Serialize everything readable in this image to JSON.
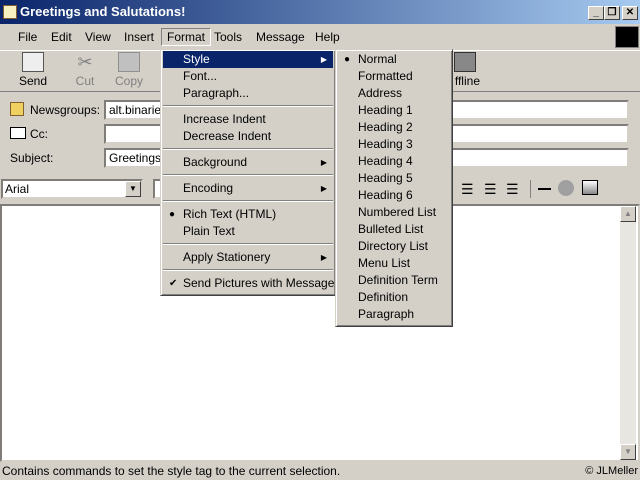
{
  "window": {
    "title": "Greetings and Salutations!",
    "minimize": "_",
    "restore": "❐",
    "close": "✕"
  },
  "menubar": [
    "File",
    "Edit",
    "View",
    "Insert",
    "Format",
    "Tools",
    "Message",
    "Help"
  ],
  "toolbar": {
    "send": "Send",
    "cut": "Cut",
    "copy": "Copy",
    "offline": "ffline"
  },
  "fields": {
    "newsgroups_label": "Newsgroups:",
    "newsgroups_value": "alt.binaries",
    "cc_label": "Cc:",
    "cc_value": "",
    "subject_label": "Subject:",
    "subject_value": "Greetings a"
  },
  "format_bar": {
    "font": "Arial",
    "size": ""
  },
  "format_menu": [
    {
      "label": "Style",
      "submenu": true,
      "highlighted": true
    },
    {
      "label": "Font..."
    },
    {
      "label": "Paragraph..."
    },
    {
      "label": "Increase Indent"
    },
    {
      "label": "Decrease Indent"
    },
    {
      "label": "Background",
      "submenu": true
    },
    {
      "label": "Encoding",
      "submenu": true
    },
    {
      "label": "Rich Text (HTML)",
      "bullet": true
    },
    {
      "label": "Plain Text"
    },
    {
      "label": "Apply Stationery",
      "submenu": true
    },
    {
      "label": "Send Pictures with Message",
      "checked": true
    }
  ],
  "style_menu": [
    "Normal",
    "Formatted",
    "Address",
    "Heading 1",
    "Heading 2",
    "Heading 3",
    "Heading 4",
    "Heading 5",
    "Heading 6",
    "Numbered List",
    "Bulleted List",
    "Directory List",
    "Menu List",
    "Definition Term",
    "Definition",
    "Paragraph"
  ],
  "style_selected": "Normal",
  "status": {
    "text": "Contains commands to set the style tag to the current selection.",
    "credit": "© JLMeller"
  }
}
